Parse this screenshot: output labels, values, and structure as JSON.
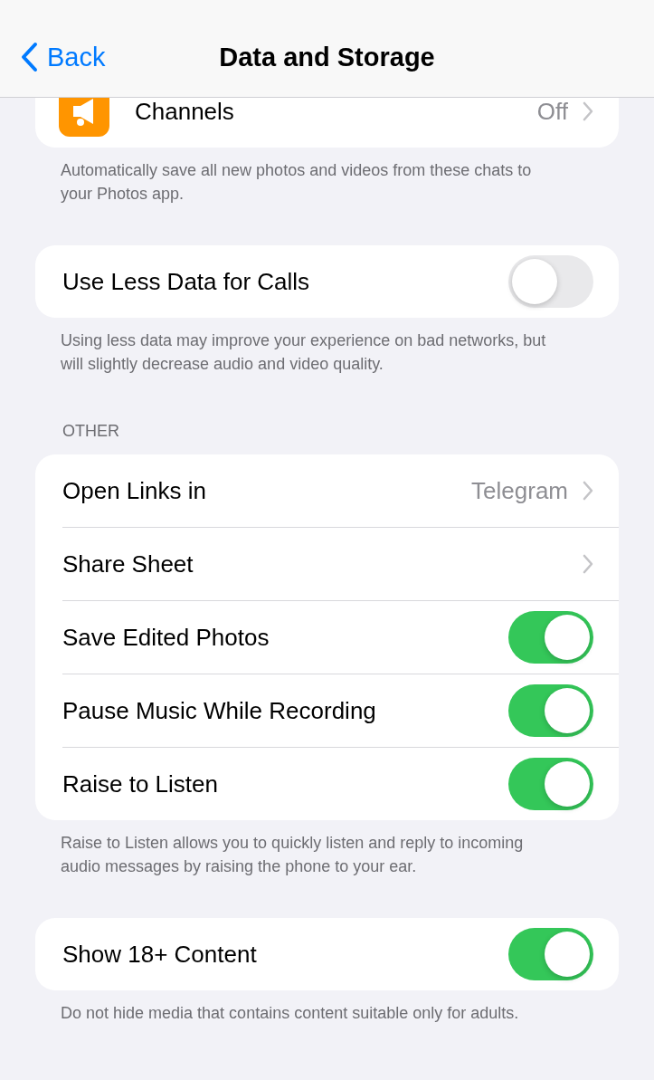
{
  "nav": {
    "back": "Back",
    "title": "Data and Storage"
  },
  "sections": [
    {
      "cut": true,
      "rows": [
        {
          "kind": "icon_link",
          "label": "Channels",
          "value": "Off"
        }
      ],
      "footer": "Automatically save all new photos and videos from these chats to your Photos app."
    },
    {
      "rows": [
        {
          "kind": "toggle",
          "label": "Use Less Data for Calls",
          "on": false
        }
      ],
      "footer": "Using less data may improve your experience on bad networks, but will slightly decrease audio and video quality."
    },
    {
      "header": "OTHER",
      "rows": [
        {
          "kind": "link",
          "label": "Open Links in",
          "value": "Telegram"
        },
        {
          "kind": "link",
          "label": "Share Sheet"
        },
        {
          "kind": "toggle",
          "label": "Save Edited Photos",
          "on": true
        },
        {
          "kind": "toggle",
          "label": "Pause Music While Recording",
          "on": true
        },
        {
          "kind": "toggle",
          "label": "Raise to Listen",
          "on": true
        }
      ],
      "footer": "Raise to Listen allows you to quickly listen and reply to incoming audio messages by raising the phone to your ear."
    },
    {
      "rows": [
        {
          "kind": "toggle",
          "label": "Show 18+ Content",
          "on": true
        }
      ],
      "footer": "Do not hide media that contains content suitable only for adults."
    }
  ]
}
